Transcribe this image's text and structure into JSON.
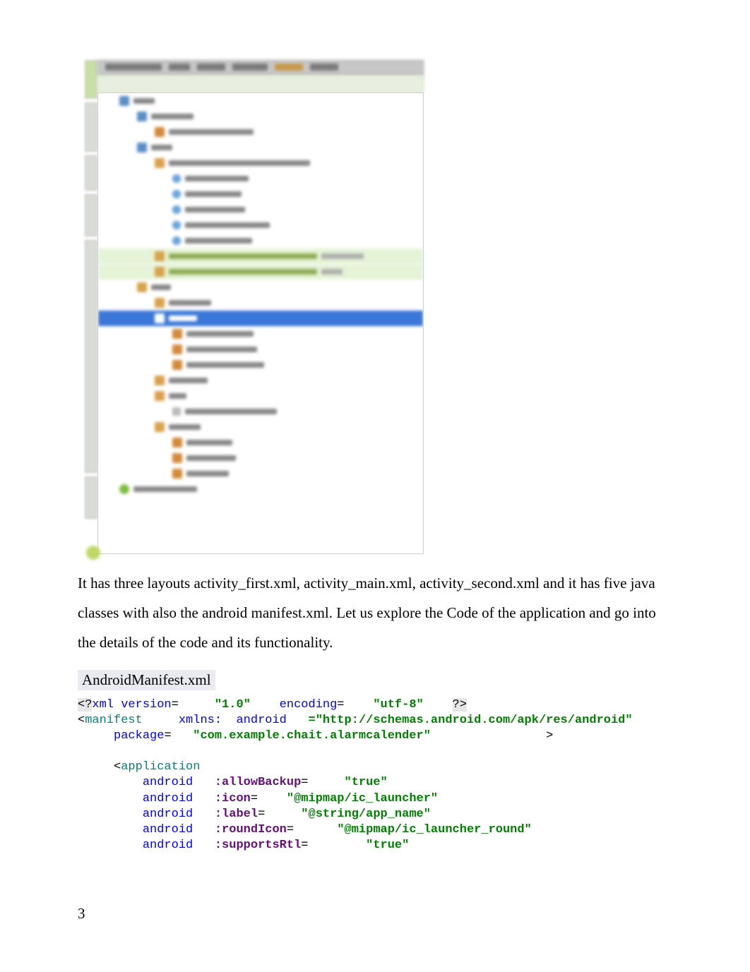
{
  "tree": {
    "root": "app",
    "manifests": "manifests",
    "manifest_file": "AndroidManifest.xml",
    "java": "java",
    "pkg_main": "com.example.chait.alarmcalender",
    "class1": "AlarmReceiver",
    "class2": "FirstActivity",
    "class3": "MainActivity",
    "class4": "NotificationService",
    "class5": "SecondActivity",
    "pkg_android_test": "com.example.chait.alarmcalender (androidTest)",
    "pkg_test": "com.example.chait.alarmcalender (test)",
    "res": "res",
    "drawable": "drawable",
    "layout": "layout",
    "layout1": "activity_first.xml",
    "layout2": "activity_main.xml",
    "layout3": "activity_second.xml",
    "mipmap": "mipmap",
    "raw": "raw",
    "raw1": "gentle_alarm.mp3",
    "values": "values",
    "val1": "colors.xml",
    "val2": "strings.xml",
    "val3": "styles.xml",
    "gradle": "Gradle Scripts"
  },
  "paragraph": "It has three layouts activity_first.xml, activity_main.xml, activity_second.xml and it has five java classes with also the android manifest.xml. Let us explore the Code of the application and go into the details of the code and its functionality.",
  "section_title": "AndroidManifest.xml",
  "code": {
    "t_open": "<?",
    "xml_version": "xml version",
    "eq": "=",
    "v10": "\"1.0\" ",
    "encoding": "encoding",
    "utf8": "\"utf-8\" ",
    "t_close": "?>",
    "lt": "<",
    "manifest": "manifest ",
    "xmlns_label": "xmlns:",
    "android": "android",
    "schema": "=\"http://schemas.android.com/apk/res/android\"",
    "package": "package",
    "pkgval": "\"com.example.chait.alarmcalender\"",
    "application": "application",
    "allowBackup": ":allowBackup",
    "true": "\"true\"",
    "icon": ":icon",
    "iconval": "\"@mipmap/ic_launcher\"",
    "label": ":label",
    "labelval": "\"@string/app_name\"",
    "roundIcon": ":roundIcon",
    "roundval": "\"@mipmap/ic_launcher_round\"",
    "supportsRtl": ":supportsRtl"
  },
  "page_number": "3"
}
